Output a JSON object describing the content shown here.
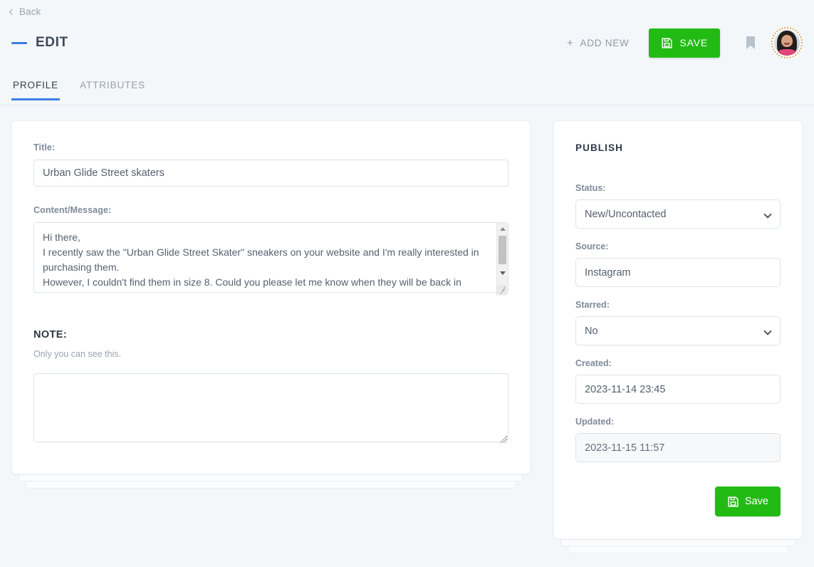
{
  "topbar": {
    "back_label": "Back",
    "back_icon": "chevron-left-icon",
    "page_title": "EDIT",
    "add_new_label": "ADD NEW",
    "add_new_icon": "plus-icon",
    "save_label": "SAVE",
    "save_icon": "floppy-disk-icon",
    "bookmark_icon": "bookmark-icon",
    "avatar_icon": "user-avatar",
    "accent_color": "#3d7fe0",
    "save_button_color": "#22bb14"
  },
  "tabs": [
    {
      "label": "PROFILE",
      "active": true
    },
    {
      "label": "ATTRIBUTES",
      "active": false
    }
  ],
  "profile_form": {
    "title_label": "Title:",
    "title_value": "Urban Glide Street skaters",
    "title_placeholder": "Title",
    "content_label": "Content/Message:",
    "content_value": "Hi there,\nI recently saw the \"Urban Glide Street Skater\" sneakers on your website and I'm really interested in purchasing them.\nHowever, I couldn't find them in size 8. Could you please let me know when they will be back in",
    "note_heading": "NOTE:",
    "note_subtext": "Only you can see this.",
    "note_value": "",
    "note_placeholder": ""
  },
  "publish": {
    "heading": "PUBLISH",
    "status_label": "Status:",
    "status_value": "New/Uncontacted",
    "status_options": [
      "New/Uncontacted"
    ],
    "source_label": "Source:",
    "source_value": "Instagram",
    "source_placeholder": "Source",
    "starred_label": "Starred:",
    "starred_value": "No",
    "starred_options": [
      "No"
    ],
    "created_label": "Created:",
    "created_value": "2023-11-14 23:45",
    "updated_label": "Updated:",
    "updated_value": "2023-11-15 11:57",
    "save_label": "Save",
    "save_icon": "floppy-disk-icon"
  }
}
